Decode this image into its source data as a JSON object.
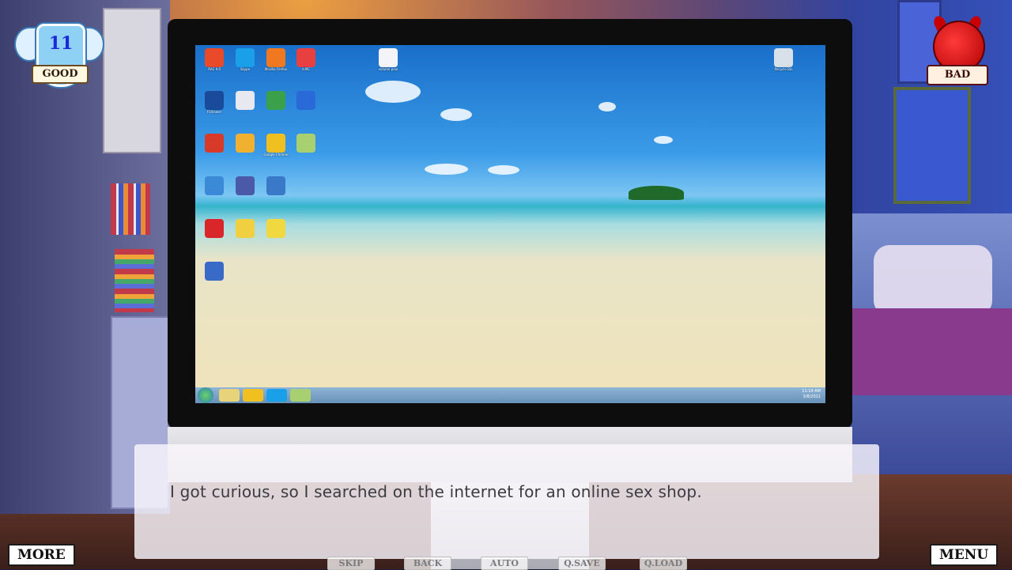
{
  "hud": {
    "good_score": "11",
    "good_label": "GOOD",
    "bad_label": "BAD"
  },
  "dialogue": {
    "text": "I got curious, so I searched on the internet for an online sex shop."
  },
  "buttons": {
    "more": "MORE",
    "menu": "MENU",
    "skip": "SKIP",
    "back": "BACK",
    "auto": "AUTO",
    "qsave": "Q.SAVE",
    "qload": "Q.LOAD"
  },
  "desktop": {
    "icons": [
      {
        "label": "AVG 9.0",
        "color": "#e84a2a"
      },
      {
        "label": "Skype",
        "color": "#1aa0e8"
      },
      {
        "label": "Mozilla Firefox",
        "color": "#f07820"
      },
      {
        "label": "mIRC",
        "color": "#e84040"
      },
      {
        "label": "FSViewer",
        "color": "#1a4a9a"
      },
      {
        "label": "",
        "color": "#e8e8f0"
      },
      {
        "label": "",
        "color": "#3aa04a"
      },
      {
        "label": "",
        "color": "#2a6ad8"
      },
      {
        "label": "",
        "color": "#d83a2a"
      },
      {
        "label": "",
        "color": "#f0b030"
      },
      {
        "label": "Google Chrome",
        "color": "#f0c020"
      },
      {
        "label": "",
        "color": "#a8d070"
      },
      {
        "label": "",
        "color": "#3a8ad8"
      },
      {
        "label": "",
        "color": "#4a5aa8"
      },
      {
        "label": "",
        "color": "#3a78c8"
      },
      {
        "label": "",
        "color": "#d8262a"
      },
      {
        "label": "",
        "color": "#f0d040"
      },
      {
        "label": "",
        "color": "#f0d840"
      },
      {
        "label": "",
        "color": "#3a6ac8"
      },
      {
        "label": "",
        "color": "#b01818"
      },
      {
        "label": "",
        "color": "#e8c020"
      },
      {
        "label": "",
        "color": "#2a8ae0"
      },
      {
        "label": "",
        "color": "#f0c040"
      },
      {
        "label": "",
        "color": "#3a90e0"
      }
    ],
    "volume_label": "volume pool",
    "recycle_label": "Recycle Bin",
    "clock_time": "11:14 AM",
    "clock_date": "3/8/2011"
  }
}
